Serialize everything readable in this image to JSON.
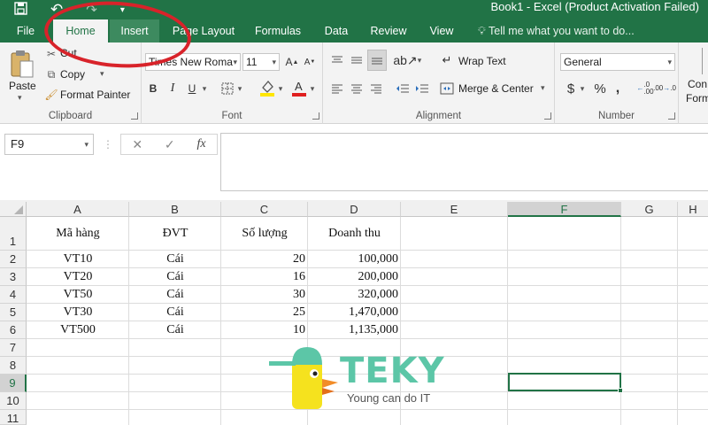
{
  "window": {
    "title": "Book1 - Excel (Product Activation Failed)"
  },
  "quick_access": [
    {
      "icon": "save-icon"
    },
    {
      "icon": "undo-icon"
    },
    {
      "icon": "redo-icon"
    },
    {
      "icon": "customize-qat-icon"
    }
  ],
  "tabs": [
    "File",
    "Home",
    "Insert",
    "Page Layout",
    "Formulas",
    "Data",
    "Review",
    "View"
  ],
  "active_tab": "Home",
  "tell_me": "Tell me what you want to do...",
  "ribbon": {
    "clipboard": {
      "label": "Clipboard",
      "paste": "Paste",
      "cut": "Cut",
      "copy": "Copy",
      "format_painter": "Format Painter"
    },
    "font": {
      "label": "Font",
      "font_name": "Times New Roma",
      "font_size": "11",
      "bold": "B",
      "italic": "I",
      "underline": "U"
    },
    "alignment": {
      "label": "Alignment",
      "wrap_text": "Wrap Text",
      "merge_center": "Merge & Center"
    },
    "number": {
      "label": "Number",
      "format": "General",
      "currency": "$",
      "percent": "%",
      "comma": ","
    },
    "styles": {
      "cond_format_1": "Con",
      "cond_format_2": "Form"
    }
  },
  "formula_bar": {
    "name_box": "F9",
    "fx": "fx",
    "value": ""
  },
  "sheet": {
    "columns": [
      "A",
      "B",
      "C",
      "D",
      "E",
      "F",
      "G",
      "H"
    ],
    "selected_column": "F",
    "rows": [
      "1",
      "2",
      "3",
      "4",
      "5",
      "6",
      "7",
      "8",
      "9",
      "10",
      "11"
    ],
    "selected_row": "9",
    "header": [
      "Mã hàng",
      "ĐVT",
      "Số lượng",
      "Doanh thu"
    ],
    "data": [
      [
        "VT10",
        "Cái",
        "20",
        "100,000"
      ],
      [
        "VT20",
        "Cái",
        "16",
        "200,000"
      ],
      [
        "VT50",
        "Cái",
        "30",
        "320,000"
      ],
      [
        "VT30",
        "Cái",
        "25",
        "1,470,000"
      ],
      [
        "VT500",
        "Cái",
        "10",
        "1,135,000"
      ]
    ]
  },
  "logo": {
    "word": "TEKY",
    "slogan": "Young can do IT"
  },
  "colors": {
    "accent": "#217346",
    "annotation": "#d8232a",
    "logo_green": "#5cc6a7",
    "logo_yellow": "#f5e21e"
  }
}
